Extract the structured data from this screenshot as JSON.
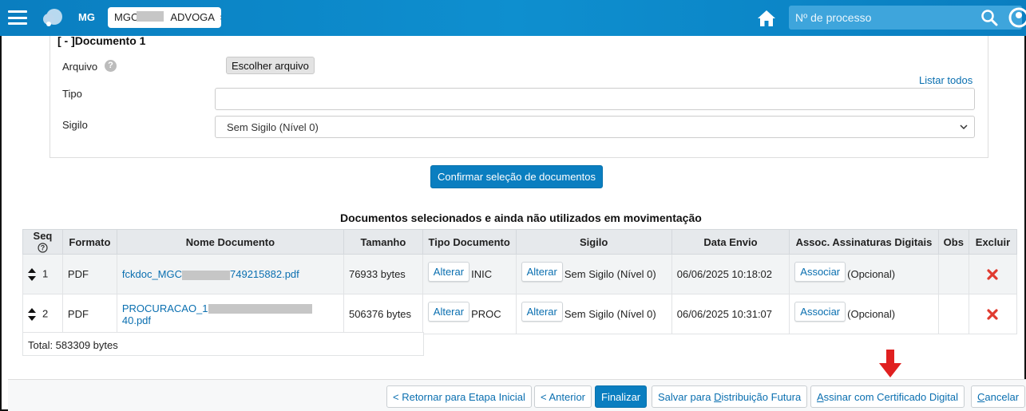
{
  "topbar": {
    "state": "MG",
    "profile_prefix": "MGC",
    "profile_suffix": "ADVOGA",
    "profile_arrow": "⬍",
    "search_placeholder": "Nº de processo",
    "brand_color": "#0a7ec0"
  },
  "document_form": {
    "legend": "[ - ]Documento 1",
    "file_label": "Arquivo",
    "file_button": "Escolher arquivo",
    "list_all": "Listar todos",
    "type_label": "Tipo",
    "type_value": "",
    "secrecy_label": "Sigilo",
    "secrecy_value": "Sem Sigilo (Nível 0)",
    "confirm_button": "Confirmar seleção de documentos"
  },
  "table": {
    "title": "Documentos selecionados e ainda não utilizados em movimentação",
    "headers": {
      "seq": "Seq",
      "format": "Formato",
      "name": "Nome Documento",
      "size": "Tamanho",
      "doc_type": "Tipo Documento",
      "secrecy": "Sigilo",
      "date": "Data Envio",
      "signatures": "Assoc. Assinaturas Digitais",
      "obs": "Obs",
      "delete": "Excluir"
    },
    "rows": [
      {
        "seq": "1",
        "format": "PDF",
        "name_prefix": "fckdoc_MGC",
        "name_suffix": "749215882.pdf",
        "size": "76933 bytes",
        "change_label": "Alterar",
        "doc_type": "INIC",
        "secrecy": "Sem Sigilo (Nível 0)",
        "date": "06/06/2025 10:18:02",
        "associate_label": "Associar",
        "optional": "(Opcional)"
      },
      {
        "seq": "2",
        "format": "PDF",
        "name_prefix": "PROCURACAO_1",
        "name_suffix": "40.pdf",
        "size": "506376 bytes",
        "change_label": "Alterar",
        "doc_type": "PROC",
        "secrecy": "Sem Sigilo (Nível 0)",
        "date": "06/06/2025 10:31:07",
        "associate_label": "Associar",
        "optional": "(Opcional)"
      }
    ],
    "total": "Total: 583309 bytes"
  },
  "footer": {
    "back_initial": "< Retornar para Etapa Inicial",
    "previous": "< Anterior",
    "finish": "Finalizar",
    "save_future_prefix": "Salvar para ",
    "save_future_underlined": "D",
    "save_future_suffix": "istribuição Futura",
    "sign_underlined": "A",
    "sign_suffix": "ssinar com Certificado Digital",
    "cancel_underlined": "C",
    "cancel_suffix": "ancelar"
  },
  "icons": {
    "menu": "hamburger-icon",
    "home": "home-icon",
    "search": "search-icon",
    "user": "user-icon",
    "help": "help-icon",
    "delete": "close-icon",
    "annotation_arrow": "arrow-down-icon",
    "delete_color": "#e03a2f",
    "arrow_color": "#e02020"
  }
}
